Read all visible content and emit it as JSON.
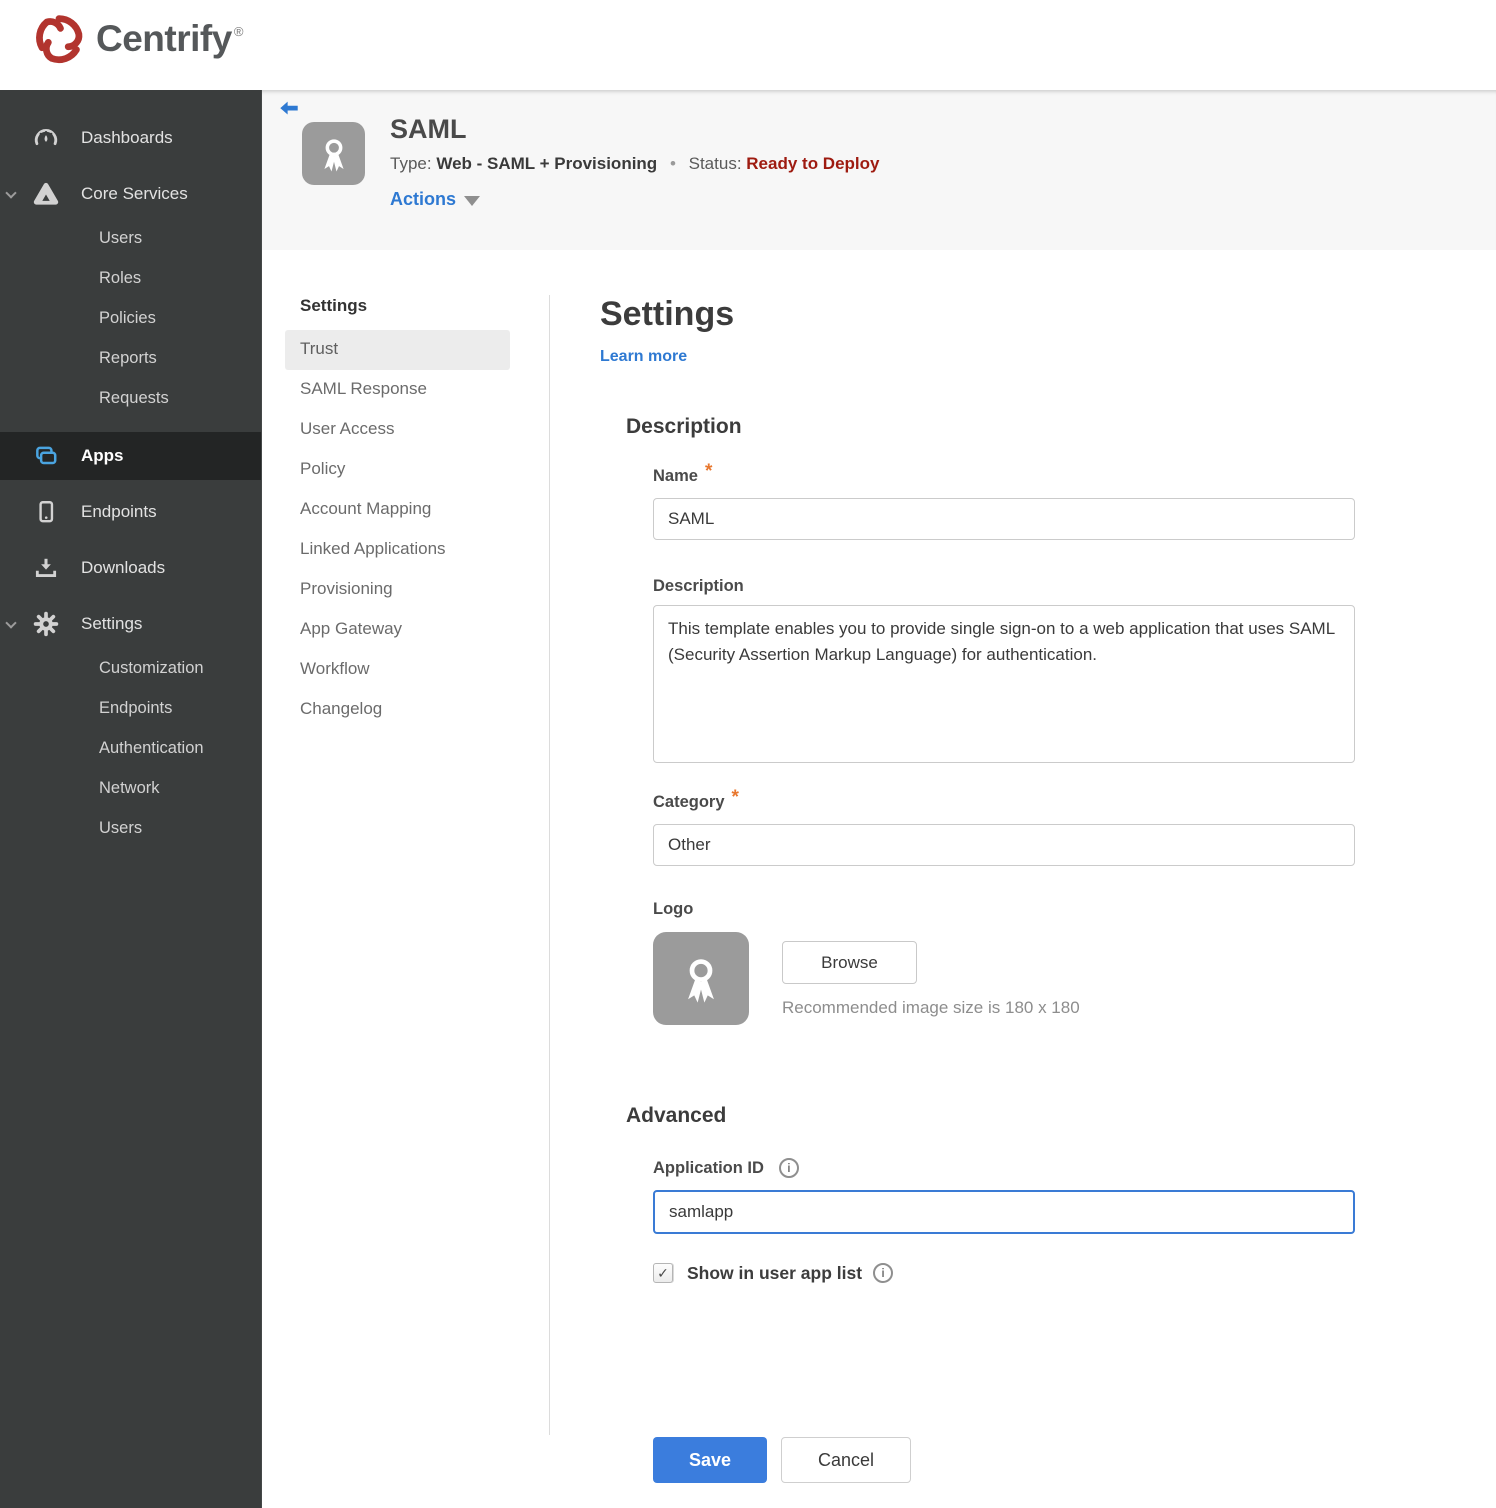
{
  "brand": {
    "name": "Centrify",
    "reg": "®"
  },
  "colors": {
    "accent_blue": "#2e79d2",
    "button_blue": "#3b7ddd",
    "apps_icon_blue": "#4aa4e0",
    "status_red": "#9e1b10",
    "required_orange": "#e8772e",
    "sidebar_bg": "#3a3d3d",
    "sidebar_active_bg": "#232525",
    "header_band": "#f7f7f7",
    "focus_border": "#3a7bd5"
  },
  "sidebar": {
    "items": [
      {
        "label": "Dashboards"
      },
      {
        "label": "Core Services",
        "children": [
          "Users",
          "Roles",
          "Policies",
          "Reports",
          "Requests"
        ]
      },
      {
        "label": "Apps"
      },
      {
        "label": "Endpoints"
      },
      {
        "label": "Downloads"
      },
      {
        "label": "Settings",
        "children": [
          "Customization",
          "Endpoints",
          "Authentication",
          "Network",
          "Users"
        ]
      }
    ]
  },
  "app_header": {
    "title": "SAML",
    "type_label": "Type:",
    "type_value": "Web - SAML + Provisioning",
    "separator": "•",
    "status_label": "Status:",
    "status_value": "Ready to Deploy",
    "actions_label": "Actions"
  },
  "subnav": {
    "header": "Settings",
    "items": [
      "Trust",
      "SAML Response",
      "User Access",
      "Policy",
      "Account Mapping",
      "Linked Applications",
      "Provisioning",
      "App Gateway",
      "Workflow",
      "Changelog"
    ]
  },
  "main": {
    "title": "Settings",
    "learn_more": "Learn more",
    "required_marker": "*",
    "description_section": {
      "heading": "Description",
      "name_label": "Name",
      "name_value": "SAML",
      "description_label": "Description",
      "description_value": "This template enables you to provide single sign-on to a web application that uses SAML (Security Assertion Markup Language) for authentication.",
      "category_label": "Category",
      "category_value": "Other",
      "logo_label": "Logo",
      "browse_label": "Browse",
      "logo_hint": "Recommended image size is 180 x 180"
    },
    "advanced_section": {
      "heading": "Advanced",
      "app_id_label": "Application ID",
      "app_id_value": "samlapp",
      "show_label": "Show in user app list",
      "checked": true
    },
    "footer": {
      "save_label": "Save",
      "cancel_label": "Cancel"
    }
  },
  "icons": {
    "info_glyph": "i",
    "check_glyph": "✓"
  }
}
